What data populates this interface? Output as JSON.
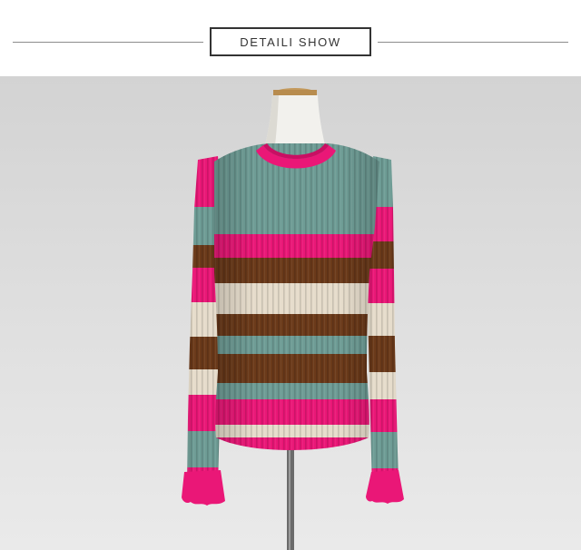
{
  "header": {
    "title": "DETAILI SHOW"
  },
  "photo": {
    "subject": "striped-ribbed-knit-sweater-on-mannequin",
    "colors": {
      "backdrop": "#dcdcdc",
      "teal": "#6e9c95",
      "pink": "#ea1777",
      "brown": "#6b3a1a",
      "cream": "#e6dccb",
      "mannequin": "#f2f1ed"
    }
  }
}
